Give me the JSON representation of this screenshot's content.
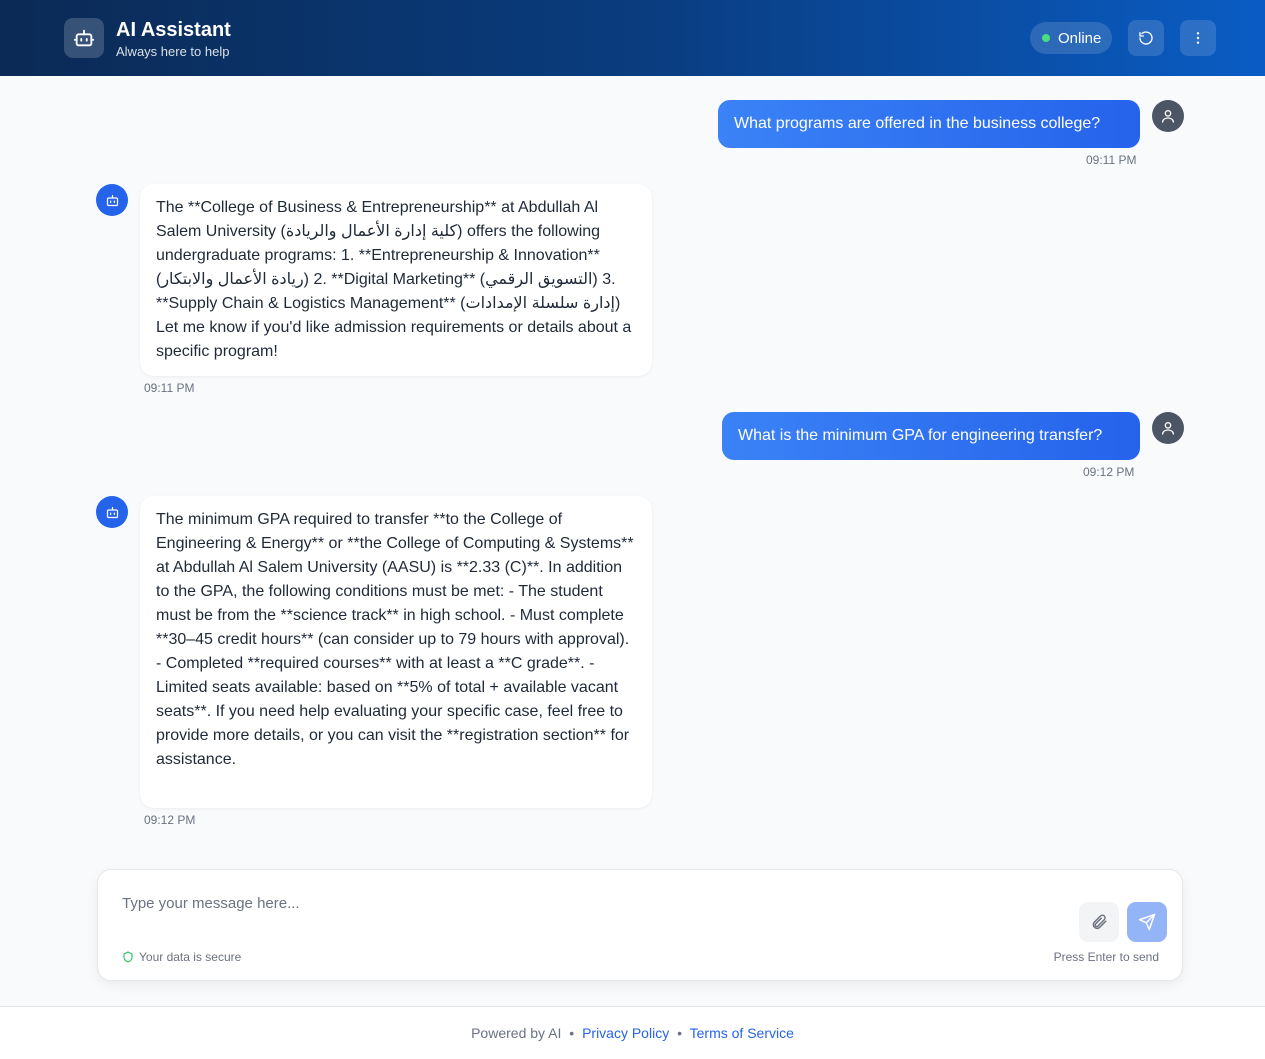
{
  "header": {
    "title": "AI Assistant",
    "subtitle": "Always here to help",
    "status": "Online",
    "colors": {
      "gradient_start": "#0b2a55",
      "gradient_end": "#0a5cc4",
      "status_dot": "#4ade80"
    }
  },
  "messages": [
    {
      "role": "user",
      "text": "What programs are offered in the business college?",
      "time": "09:11 PM"
    },
    {
      "role": "bot",
      "text": "The **College of Business & Entrepreneurship** at Abdullah Al Salem University (كلية إدارة الأعمال والريادة) offers the following undergraduate programs: 1. **Entrepreneurship & Innovation** (ريادة الأعمال والابتكار) 2. **Digital Marketing** (التسويق الرقمي) 3. **Supply Chain & Logistics Management** (إدارة سلسلة الإمدادات) Let me know if you'd like admission requirements or details about a specific program!",
      "time": "09:11 PM"
    },
    {
      "role": "user",
      "text": "What is the minimum GPA for engineering transfer?",
      "time": "09:12 PM"
    },
    {
      "role": "bot",
      "text": "The minimum GPA required to transfer **to the College of Engineering & Energy** or **the College of Computing & Systems** at Abdullah Al Salem University (AASU) is **2.33 (C)**. In addition to the GPA, the following conditions must be met: - The student must be from the **science track** in high school. - Must complete **30–45 credit hours** (can consider up to 79 hours with approval). - Completed **required courses** with at least a **C grade**. - Limited seats available: based on **5% of total + available vacant seats**. If you need help evaluating your specific case, feel free to provide more details, or you can visit the **registration section** for assistance.",
      "time": "09:12 PM"
    }
  ],
  "input": {
    "placeholder": "Type your message here...",
    "secure_note": "Your data is secure",
    "hint": "Press Enter to send"
  },
  "footer": {
    "powered": "Powered by AI",
    "privacy": "Privacy Policy",
    "terms": "Terms of Service",
    "separator": "•"
  },
  "icons": {
    "logo": "robot-icon",
    "refresh": "refresh-icon",
    "menu": "more-vertical-icon",
    "user_avatar": "user-icon",
    "bot_avatar": "robot-icon",
    "attach": "paperclip-icon",
    "send": "send-icon",
    "secure": "shield-icon"
  }
}
